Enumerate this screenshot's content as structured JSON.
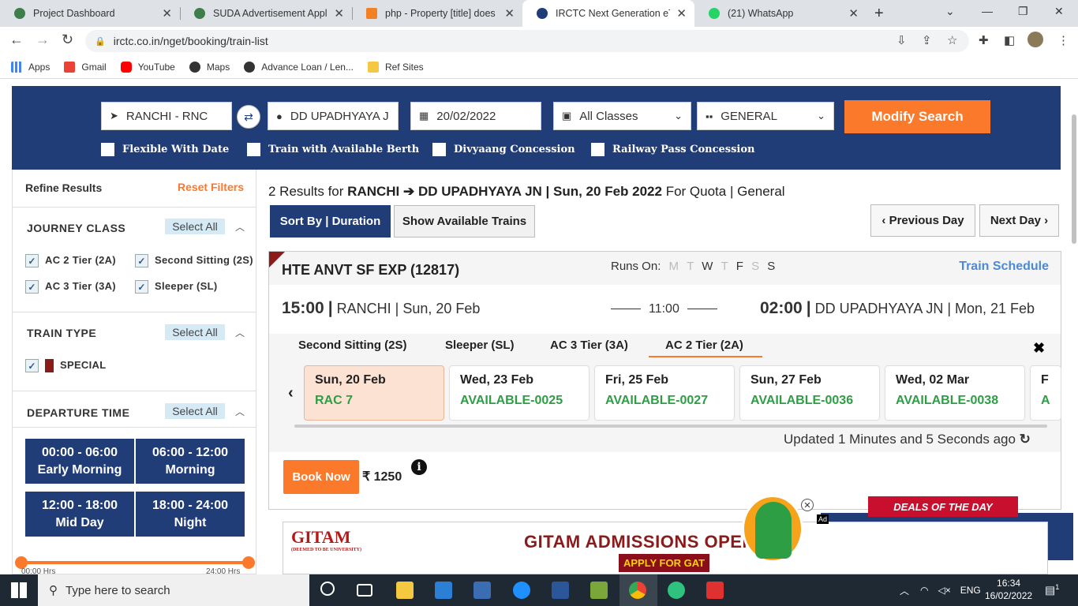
{
  "browser": {
    "tabs": [
      {
        "title": "Project Dashboard",
        "color": "#3d7e4a"
      },
      {
        "title": "SUDA Advertisement Applica",
        "color": "#3d7e4a"
      },
      {
        "title": "php - Property [title] does no",
        "color": "#f48024"
      },
      {
        "title": "IRCTC Next Generation eTick",
        "color": "#213d77"
      },
      {
        "title": "(21) WhatsApp",
        "color": "#25d366"
      }
    ],
    "url": "irctc.co.in/nget/booking/train-list",
    "bookmarks": [
      "Apps",
      "Gmail",
      "YouTube",
      "Maps",
      "Advance Loan / Len...",
      "Ref Sites"
    ]
  },
  "search": {
    "from": "RANCHI - RNC",
    "to": "DD UPADHYAYA J",
    "date": "20/02/2022",
    "class": "All Classes",
    "quota": "GENERAL",
    "modify_label": "Modify Search",
    "checks": [
      "Flexible With Date",
      "Train with Available Berth",
      "Divyaang Concession",
      "Railway Pass Concession"
    ]
  },
  "sidebar": {
    "refine": "Refine Results",
    "reset": "Reset Filters",
    "journey_class": "JOURNEY CLASS",
    "select_all": "Select All",
    "classes": [
      "AC 2 Tier (2A)",
      "Second Sitting (2S)",
      "AC 3 Tier (3A)",
      "Sleeper (SL)"
    ],
    "train_type": "TRAIN TYPE",
    "special": "SPECIAL",
    "departure_time": "DEPARTURE TIME",
    "slots": [
      {
        "time": "00:00 - 06:00",
        "name": "Early Morning"
      },
      {
        "time": "06:00 - 12:00",
        "name": "Morning"
      },
      {
        "time": "12:00 - 18:00",
        "name": "Mid Day"
      },
      {
        "time": "18:00 - 24:00",
        "name": "Night"
      }
    ],
    "slider_min": "00:00 Hrs",
    "slider_max": "24:00 Hrs"
  },
  "results": {
    "count_text": "2 Results for",
    "route": "RANCHI ➔ DD UPADHYAYA JN | Sun, 20 Feb 2022",
    "quota_text": "For Quota | General",
    "sort_label": "Sort By | Duration",
    "show_available": "Show Available Trains",
    "prev_day": "Previous Day",
    "next_day": "Next Day"
  },
  "train": {
    "name": "HTE ANVT SF EXP (12817)",
    "runs_on": "Runs On:",
    "days": [
      {
        "d": "M",
        "active": false
      },
      {
        "d": "T",
        "active": false
      },
      {
        "d": "W",
        "active": true
      },
      {
        "d": "T",
        "active": false
      },
      {
        "d": "F",
        "active": true
      },
      {
        "d": "S",
        "active": false
      },
      {
        "d": "S",
        "active": true
      }
    ],
    "schedule_label": "Train Schedule",
    "dep_time": "15:00",
    "dep_station": "RANCHI | Sun, 20 Feb",
    "duration": "11:00",
    "arr_time": "02:00",
    "arr_station": "DD UPADHYAYA JN | Mon, 21 Feb",
    "class_tabs": [
      "Second Sitting (2S)",
      "Sleeper (SL)",
      "AC 3 Tier (3A)",
      "AC 2 Tier (2A)"
    ],
    "availability": [
      {
        "date": "Sun, 20 Feb",
        "status": "RAC 7"
      },
      {
        "date": "Wed, 23 Feb",
        "status": "AVAILABLE-0025"
      },
      {
        "date": "Fri, 25 Feb",
        "status": "AVAILABLE-0027"
      },
      {
        "date": "Sun, 27 Feb",
        "status": "AVAILABLE-0036"
      },
      {
        "date": "Wed, 02 Mar",
        "status": "AVAILABLE-0038"
      },
      {
        "date": "F",
        "status": "A"
      }
    ],
    "updated": "Updated 1 Minutes and 5 Seconds ago",
    "book_label": "Book Now",
    "price": "₹ 1250"
  },
  "ad": {
    "logo": "GITAM",
    "logo_sub": "(DEEMED TO BE UNIVERSITY)",
    "headline": "GITAM ADMISSIONS OPEN",
    "cta": "APPLY FOR GAT",
    "deals": "DEALS OF THE DAY",
    "tag": "Ad"
  },
  "taskbar": {
    "search_placeholder": "Type here to search",
    "lang": "ENG",
    "time": "16:34",
    "date": "16/02/2022",
    "notif": "1"
  },
  "colors": {
    "brand_blue": "#213d77",
    "accent_orange": "#fb792b",
    "available_green": "#2e9e45",
    "link_blue": "#4a8ad6"
  }
}
